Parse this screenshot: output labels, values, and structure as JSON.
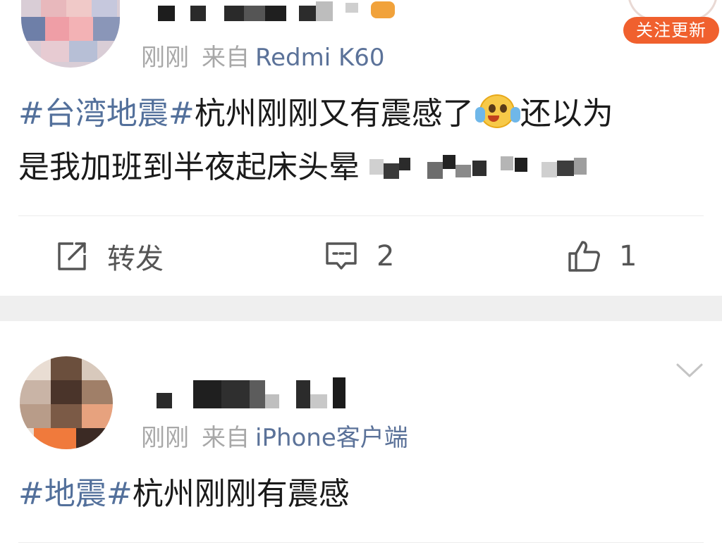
{
  "post1": {
    "time": "刚刚",
    "source_prefix": "来自",
    "device": "Redmi K60",
    "content_tag": "#台湾地震#",
    "content_text_a": "杭州刚刚又有震感了",
    "content_text_b": "还以为",
    "content_line2": "是我加班到半夜起床头晕",
    "emoji_icon": "laughing-crying-face",
    "follow_button": "关注更新",
    "actions": {
      "repost_label": "转发",
      "comment_count": "2",
      "like_count": "1"
    }
  },
  "post2": {
    "time": "刚刚",
    "source_prefix": "来自",
    "device": "iPhone客户端",
    "content_tag": "#地震#",
    "content_text": "杭州刚刚有震感"
  },
  "colors": {
    "tag_blue": "#53709b",
    "accent_orange": "#f0602e",
    "meta_gray": "#a8a8a8",
    "separator": "#efefef"
  }
}
